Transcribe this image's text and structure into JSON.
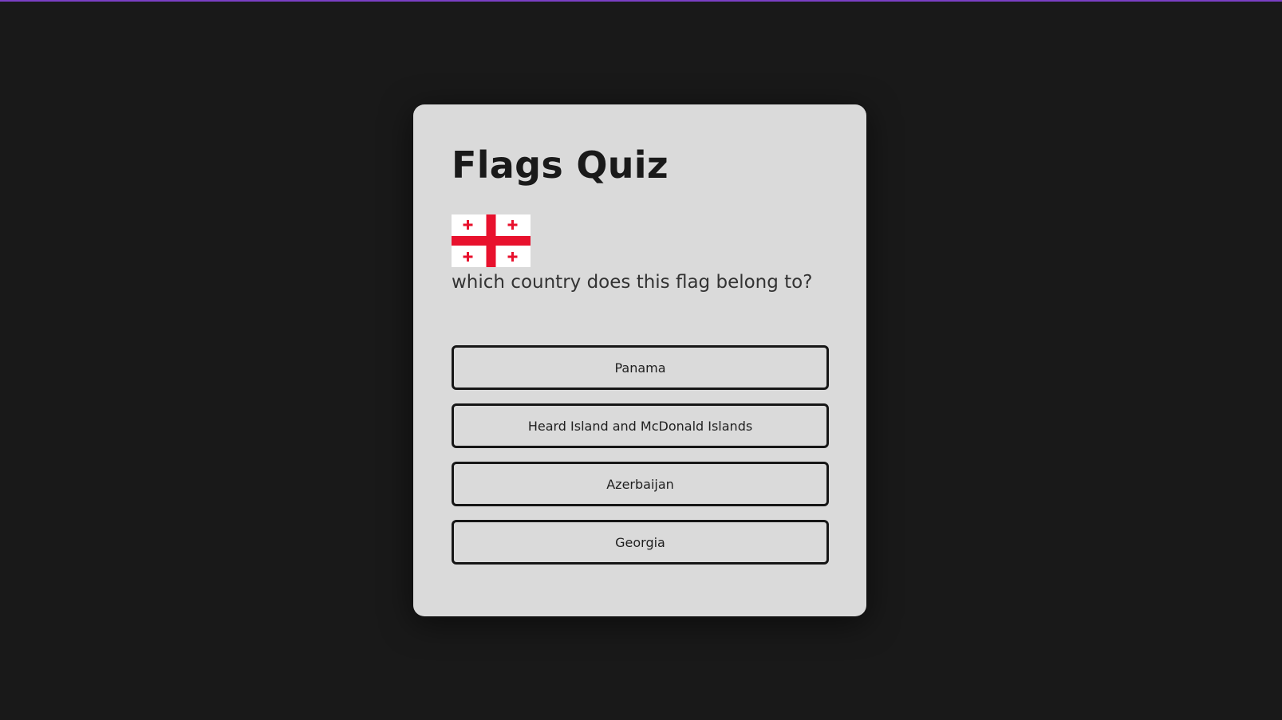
{
  "quiz": {
    "title": "Flags Quiz",
    "question": "which country does this flag belong to?",
    "flag_icon": "georgia-flag",
    "answers": [
      {
        "label": "Panama"
      },
      {
        "label": "Heard Island and McDonald Islands"
      },
      {
        "label": "Azerbaijan"
      },
      {
        "label": "Georgia"
      }
    ]
  },
  "colors": {
    "background": "#191919",
    "card": "#dadada",
    "accent_bar": "#7a3fc4",
    "flag_red": "#e8112d",
    "flag_white": "#ffffff"
  }
}
